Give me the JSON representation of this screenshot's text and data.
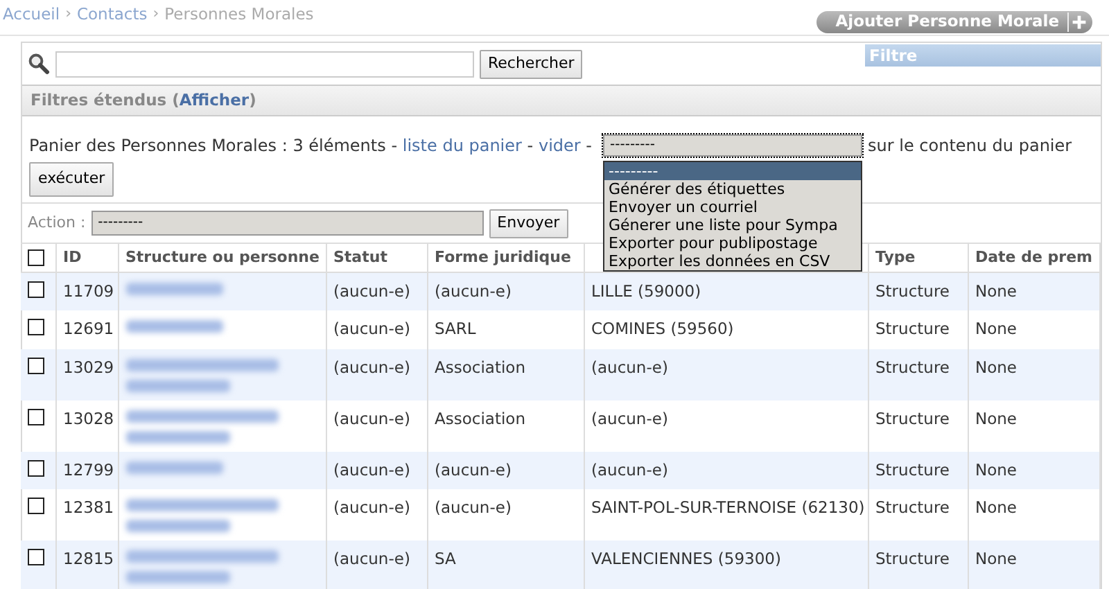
{
  "breadcrumb": [
    {
      "label": "Accueil",
      "kind": "link"
    },
    {
      "label": "›",
      "kind": "sep"
    },
    {
      "label": "Contacts",
      "kind": "link"
    },
    {
      "label": "›",
      "kind": "sep"
    },
    {
      "label": "Personnes Morales",
      "kind": "current"
    }
  ],
  "add_button": {
    "label": "Ajouter Personne Morale"
  },
  "search": {
    "button": "Rechercher"
  },
  "filter_panel": {
    "title": "Filtre"
  },
  "extended_filters": {
    "label": "Filtres étendus (",
    "link": "Afficher",
    "suffix": ")"
  },
  "basket": {
    "text": "Panier des Personnes Morales : 3 éléments",
    "sep1": "-",
    "list_link": "liste du panier",
    "sep2": "-",
    "empty_link": "vider",
    "sep3": "-",
    "select_value": "---------",
    "after": "sur le contenu du panier",
    "execute_button": "exécuter",
    "dropdown": {
      "expanded": true,
      "options": [
        {
          "label": "---------",
          "selected": true
        },
        {
          "label": "Générer des étiquettes",
          "selected": false
        },
        {
          "label": "Envoyer un courriel",
          "selected": false
        },
        {
          "label": "Génerer une liste pour Sympa",
          "selected": false
        },
        {
          "label": "Exporter pour publipostage",
          "selected": false
        },
        {
          "label": "Exporter les données en CSV",
          "selected": false
        }
      ]
    }
  },
  "action": {
    "label": "Action :",
    "select_value": "---------",
    "button": "Envoyer"
  },
  "table": {
    "select_all_checked": false,
    "columns": [
      {
        "label": "ID"
      },
      {
        "label": "Structure ou personne"
      },
      {
        "label": "Statut"
      },
      {
        "label": "Forme juridique"
      },
      {},
      {
        "label": "Type"
      },
      {
        "label": "Date de prem"
      }
    ],
    "rows": [
      {
        "checked": false,
        "id": "11709",
        "name_wrapped": false,
        "statut": "(aucun-e)",
        "forme": "(aucun-e)",
        "ville": "LILLE (59000)",
        "type": "Structure",
        "date": "None"
      },
      {
        "checked": false,
        "id": "12691",
        "name_wrapped": false,
        "statut": "(aucun-e)",
        "forme": "SARL",
        "ville": "COMINES (59560)",
        "type": "Structure",
        "date": "None"
      },
      {
        "checked": false,
        "id": "13029",
        "name_wrapped": true,
        "statut": "(aucun-e)",
        "forme": "Association",
        "ville": "(aucun-e)",
        "type": "Structure",
        "date": "None"
      },
      {
        "checked": false,
        "id": "13028",
        "name_wrapped": true,
        "statut": "(aucun-e)",
        "forme": "Association",
        "ville": "(aucun-e)",
        "type": "Structure",
        "date": "None"
      },
      {
        "checked": false,
        "id": "12799",
        "name_wrapped": false,
        "statut": "(aucun-e)",
        "forme": "(aucun-e)",
        "ville": "(aucun-e)",
        "type": "Structure",
        "date": "None"
      },
      {
        "checked": false,
        "id": "12381",
        "name_wrapped": true,
        "statut": "(aucun-e)",
        "forme": "(aucun-e)",
        "ville": "SAINT-POL-SUR-TERNOISE (62130)",
        "type": "Structure",
        "date": "None"
      },
      {
        "checked": false,
        "id": "12815",
        "name_wrapped": true,
        "statut": "(aucun-e)",
        "forme": "SA",
        "ville": "VALENCIENNES (59300)",
        "type": "Structure",
        "date": "None"
      }
    ]
  }
}
